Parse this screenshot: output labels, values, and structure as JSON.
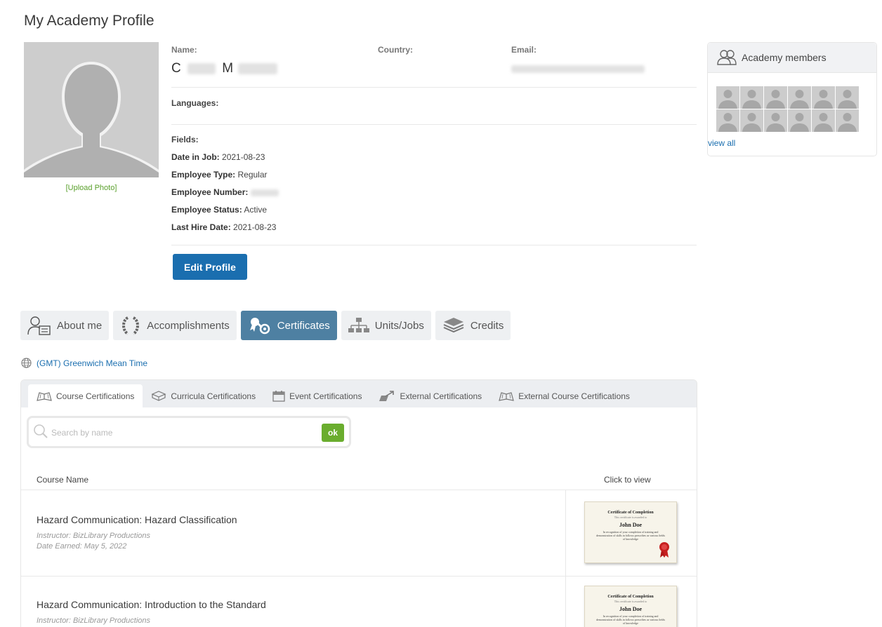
{
  "page": {
    "title": "My Academy Profile"
  },
  "avatar": {
    "upload_label": "[Upload Photo]"
  },
  "profile": {
    "name_label": "Name:",
    "name_first_initial": "C",
    "name_last_initial": "M",
    "country_label": "Country:",
    "country_value": "",
    "email_label": "Email:",
    "languages_label": "Languages:",
    "fields_label": "Fields:",
    "date_in_job_label": "Date in Job:",
    "date_in_job_value": "2021-08-23",
    "employee_type_label": "Employee Type:",
    "employee_type_value": "Regular",
    "employee_number_label": "Employee Number:",
    "employee_status_label": "Employee Status:",
    "employee_status_value": "Active",
    "last_hire_date_label": "Last Hire Date:",
    "last_hire_date_value": "2021-08-23",
    "edit_button": "Edit Profile"
  },
  "members": {
    "title": "Academy members",
    "view_all": "view all",
    "count": 12
  },
  "tabs": [
    {
      "label": "About me",
      "icon": "user-card-icon"
    },
    {
      "label": "Accomplishments",
      "icon": "laurel-icon"
    },
    {
      "label": "Certificates",
      "icon": "certificate-ribbon-icon",
      "active": true
    },
    {
      "label": "Units/Jobs",
      "icon": "org-chart-icon"
    },
    {
      "label": "Credits",
      "icon": "stack-icon"
    }
  ],
  "timezone": "(GMT) Greenwich Mean Time",
  "subtabs": [
    {
      "label": "Course Certifications",
      "active": true
    },
    {
      "label": "Curricula Certifications"
    },
    {
      "label": "Event Certifications"
    },
    {
      "label": "External Certifications"
    },
    {
      "label": "External Course Certifications"
    }
  ],
  "search": {
    "placeholder": "Search by name",
    "button": "ok"
  },
  "table": {
    "col_name": "Course Name",
    "col_view": "Click to view",
    "rows": [
      {
        "title": "Hazard Communication: Hazard Classification",
        "instructor": "Instructor: BizLibrary Productions",
        "date": "Date Earned: May 5, 2022"
      },
      {
        "title": "Hazard Communication: Introduction to the Standard",
        "instructor": "Instructor: BizLibrary Productions",
        "date": ""
      }
    ]
  },
  "certificate": {
    "title": "Certificate of Completion",
    "subtitle": "This certificate is awarded to",
    "name": "John Doe",
    "desc": "In recognition of your completion of training and demonstration of skills in follows prescribes as various fields of knowledge"
  },
  "colors": {
    "primary": "#1a6eaf",
    "active_tab": "#4e80a2",
    "success": "#6aad2e",
    "upload": "#5aa02c"
  }
}
